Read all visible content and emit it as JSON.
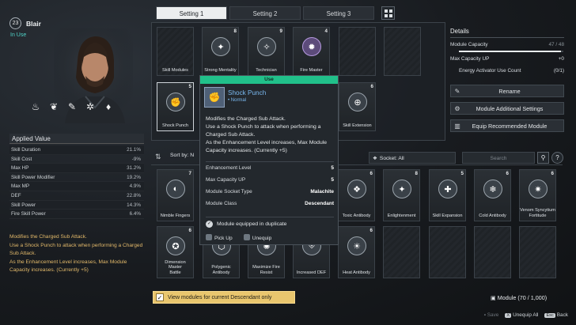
{
  "character": {
    "level": "23",
    "name": "Blair",
    "status": "In Use"
  },
  "element_icons": [
    "flame-icon",
    "chill-icon",
    "gun-icon",
    "gear-icon",
    "fire-icon"
  ],
  "applied": {
    "title": "Applied Value",
    "stats": [
      {
        "label": "Skill Duration",
        "value": "21.1%"
      },
      {
        "label": "Skill Cost",
        "value": "-9%"
      },
      {
        "label": "Max HP",
        "value": "31.2%"
      },
      {
        "label": "Skill Power Modifier",
        "value": "19.2%"
      },
      {
        "label": "Max MP",
        "value": "4.9%"
      },
      {
        "label": "DEF",
        "value": "22.8%"
      },
      {
        "label": "Skill Power",
        "value": "14.3%"
      },
      {
        "label": "Fire Skill Power",
        "value": "6.4%"
      }
    ],
    "description": "Modifies the Charged Sub Attack.\nUse a Shock Punch to attack when performing a Charged Sub Attack.\nAs the Enhancement Level increases, Max Module Capacity increases. (Currently +5)"
  },
  "tabs": [
    "Setting 1",
    "Setting 2",
    "Setting 3"
  ],
  "equipped": [
    {
      "cost": "",
      "name": "Skill Modules",
      "icon": ""
    },
    {
      "cost": "8",
      "name": "Strong Mentality",
      "icon": "✦"
    },
    {
      "cost": "9",
      "name": "Technician",
      "icon": "✧"
    },
    {
      "cost": "4",
      "name": "Fire Master",
      "icon": "✹"
    },
    {
      "cost": "",
      "name": "",
      "icon": ""
    },
    {
      "cost": "",
      "name": "",
      "icon": ""
    },
    {
      "cost": "5",
      "name": "Shock Punch",
      "icon": "✊"
    },
    {
      "cost": "6",
      "name": "Skill Extension",
      "icon": "⊕"
    }
  ],
  "details": {
    "title": "Details",
    "capacity_label": "Module Capacity",
    "capacity_value": "47 / 48",
    "capacity_fraction": 0.979,
    "max_cap_label": "Max Capacity UP",
    "max_cap_value": "+0",
    "energy_label": "Energy Activator Use Count",
    "energy_value": "(0/1)",
    "buttons": [
      "Rename",
      "Module Additional Settings",
      "Equip Recommended Module"
    ]
  },
  "filter": {
    "sort_label": "Sort by: N",
    "socket_label": "Socket: All",
    "search_placeholder": "Search"
  },
  "inventory_row1": [
    {
      "cost": "7",
      "name": "Nimble Fingers",
      "icon": "◐"
    },
    {
      "cost": "6",
      "name": "Toxic Antibody",
      "icon": "❖"
    },
    {
      "cost": "8",
      "name": "Enlightenment",
      "icon": "✦"
    },
    {
      "cost": "5",
      "name": "Skill Expansion",
      "icon": "✚"
    },
    {
      "cost": "6",
      "name": "Cold Antibody",
      "icon": "❄"
    },
    {
      "cost": "6",
      "name": "Venom Syncytium\nFortitude",
      "icon": "✷"
    }
  ],
  "inventory_row2": [
    {
      "cost": "6",
      "name": "Dimension Master\nBattle",
      "icon": "✪"
    },
    {
      "cost": "6",
      "name": "Polygenic Antibody",
      "icon": "⬡"
    },
    {
      "cost": "6",
      "name": "Maximize Fire Resist",
      "icon": "✺"
    },
    {
      "cost": "6",
      "name": "Increased DEF",
      "icon": "⛨"
    },
    {
      "cost": "6",
      "name": "Heat Antibody",
      "icon": "☀"
    }
  ],
  "tooltip": {
    "header": "Use",
    "name": "Shock Punch",
    "tier": "• Normal",
    "description": "Modifies the Charged Sub Attack.\nUse a Shock Punch to attack when performing a Charged Sub Attack.\nAs the Enhancement Level increases, Max Module Capacity increases. (Currently +5)",
    "rows": [
      {
        "label": "Enhancement Level",
        "value": "5"
      },
      {
        "label": "Max Capacity UP",
        "value": "5"
      },
      {
        "label": "Module Socket Type",
        "value": "Malachite"
      },
      {
        "label": "Module Class",
        "value": "Descendant"
      }
    ],
    "duplicate": "Module equipped in duplicate",
    "pick_up": "Pick Up",
    "unequip": "Unequip"
  },
  "bottom": {
    "toggle_label": "View modules for current Descendant only",
    "module_count": "Module (70 / 1,000)",
    "footer": [
      {
        "key": "",
        "label": "Save",
        "dim": true
      },
      {
        "key": "X",
        "label": "Unequip All",
        "dim": false
      },
      {
        "key": "Esc",
        "label": "Back",
        "dim": false
      }
    ]
  }
}
